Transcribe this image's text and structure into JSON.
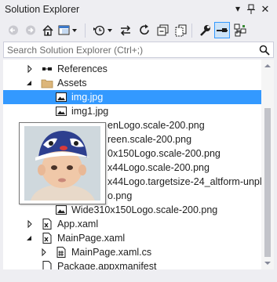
{
  "window": {
    "title": "Solution Explorer"
  },
  "search": {
    "placeholder": "Search Solution Explorer (Ctrl+;)"
  },
  "tree": {
    "rows": [
      {
        "label": "References",
        "icon": "references-icon",
        "expander": "collapsed"
      },
      {
        "label": "Assets",
        "icon": "folder-icon",
        "expander": "expanded"
      },
      {
        "label": "img.jpg",
        "icon": "image-file-icon",
        "selected": true
      },
      {
        "label": "img1.jpg",
        "icon": "image-file-icon"
      },
      {
        "label": "enLogo.scale-200.png",
        "icon": "image-file-icon"
      },
      {
        "label": "reen.scale-200.png",
        "icon": "image-file-icon"
      },
      {
        "label": "0x150Logo.scale-200.png",
        "icon": "image-file-icon"
      },
      {
        "label": "x44Logo.scale-200.png",
        "icon": "image-file-icon"
      },
      {
        "label": "x44Logo.targetsize-24_altform-unpla",
        "icon": "image-file-icon"
      },
      {
        "label": "o.png",
        "icon": "image-file-icon"
      },
      {
        "label": "Wide310x150Logo.scale-200.png",
        "icon": "image-file-icon"
      },
      {
        "label": "App.xaml",
        "icon": "xaml-file-icon",
        "expander": "collapsed"
      },
      {
        "label": "MainPage.xaml",
        "icon": "xaml-file-icon",
        "expander": "expanded"
      },
      {
        "label": "MainPage.xaml.cs",
        "icon": "csharp-file-icon",
        "expander": "collapsed"
      },
      {
        "label": "Package.appxmanifest",
        "icon": "manifest-file-icon"
      }
    ]
  },
  "preview": {
    "subject": "baby-photo-preview"
  },
  "colors": {
    "selection": "#3399ff",
    "chrome": "#eeeef2",
    "accent": "#007acc"
  }
}
